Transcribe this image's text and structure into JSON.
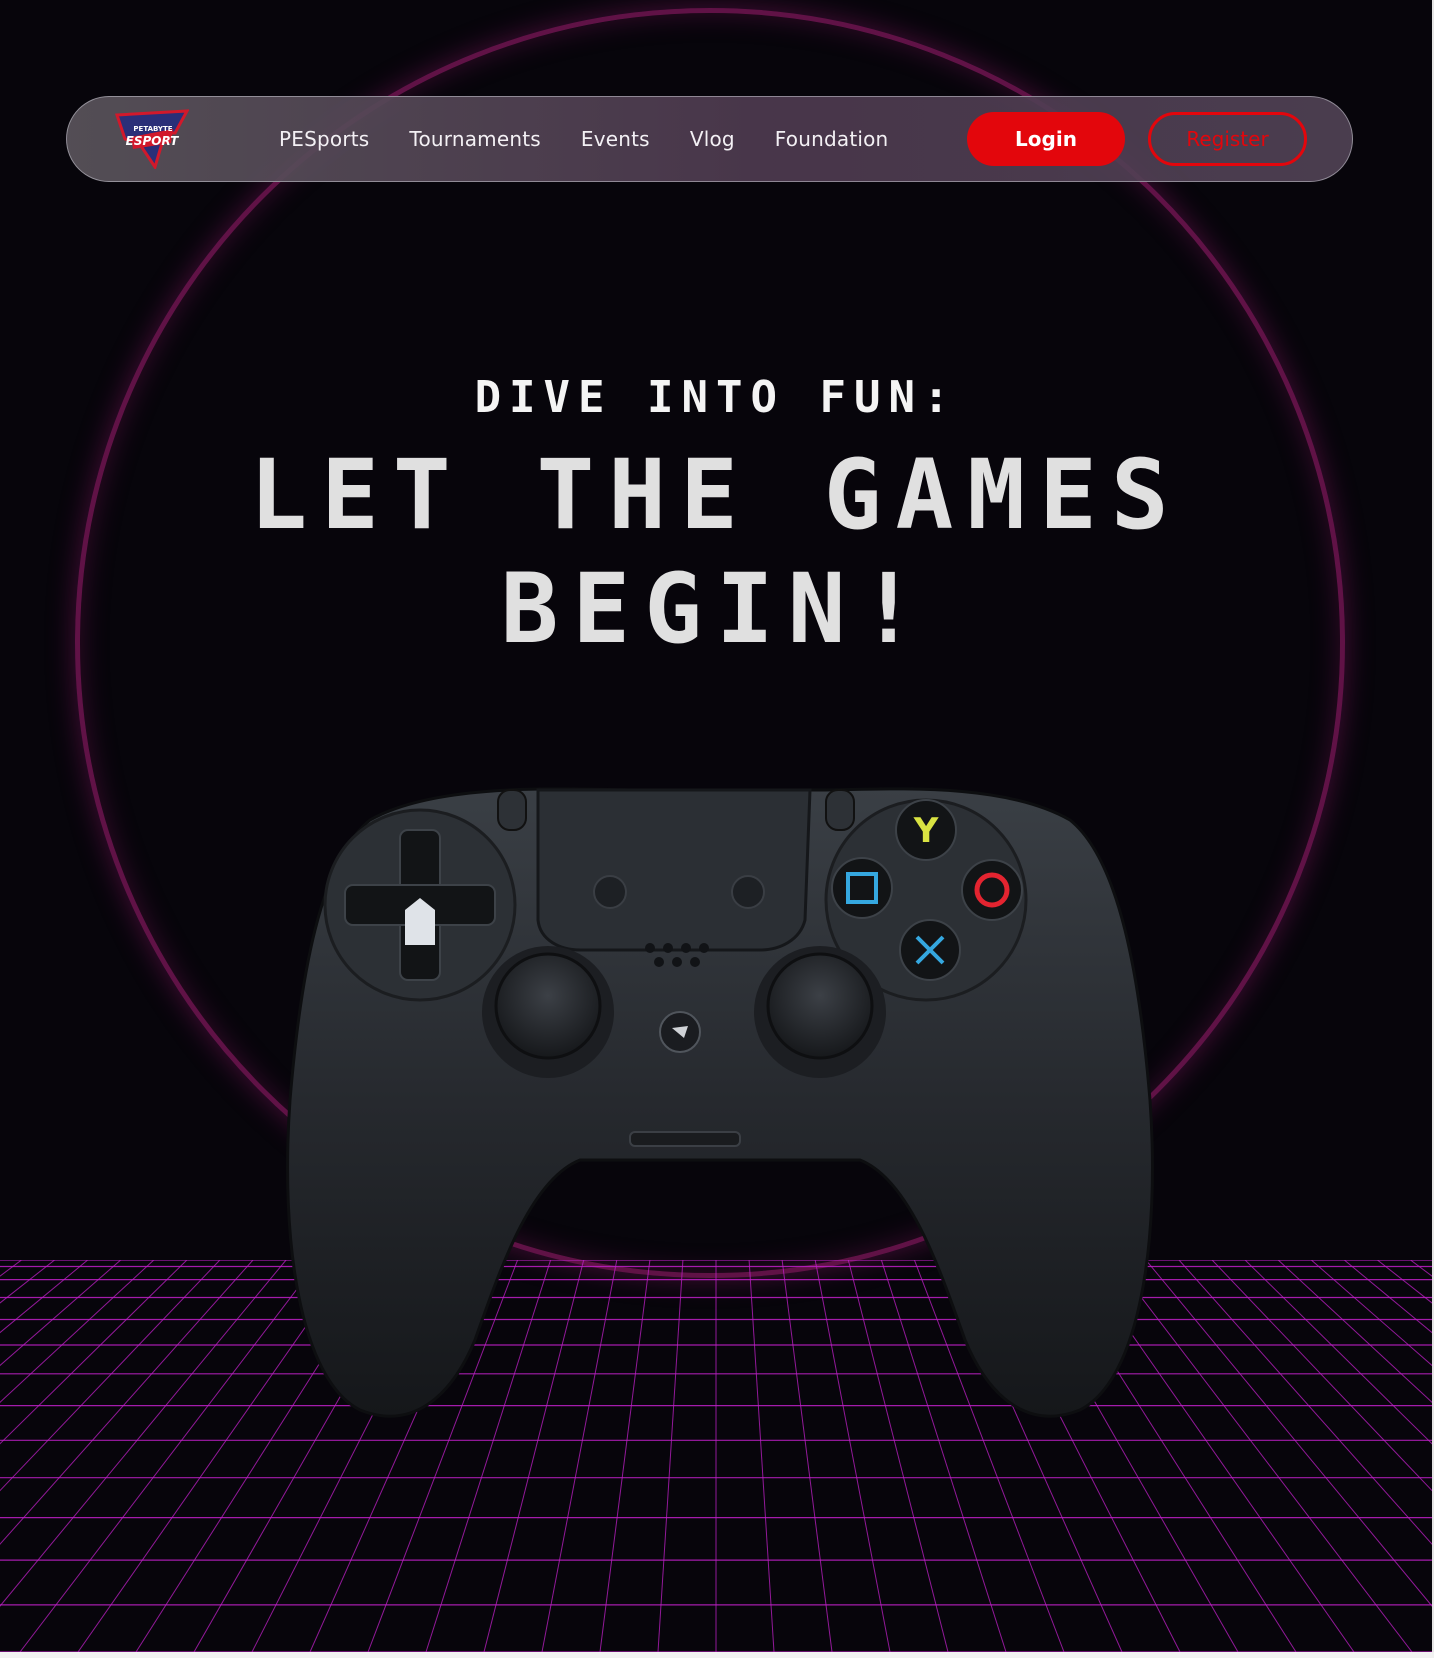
{
  "nav": {
    "logo_text_top": "PETABYTE",
    "logo_text_main": "ESPORT",
    "links": [
      "PESports",
      "Tournaments",
      "Events",
      "Vlog",
      "Foundation"
    ],
    "login_label": "Login",
    "register_label": "Register"
  },
  "hero": {
    "subheading": "DIVE INTO FUN:",
    "headline_line1": "LET THE GAMES",
    "headline_line2": "BEGIN!"
  },
  "controller": {
    "button_y": "Y",
    "button_square": "□",
    "button_circle": "O",
    "button_cross": "X"
  },
  "colors": {
    "background": "#07050b",
    "accent_red": "#e3060c",
    "grid_magenta": "#c020c8",
    "ring_glow": "#aa1e78"
  }
}
